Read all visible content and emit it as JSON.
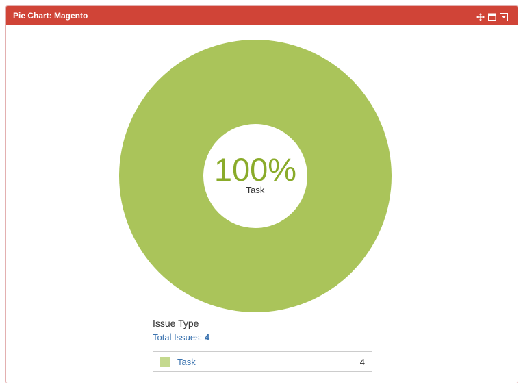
{
  "gadget": {
    "title": "Pie Chart: Magento",
    "icons": [
      "move-icon",
      "maximize-icon",
      "menu-dropdown-icon"
    ],
    "header_color": "#d04437"
  },
  "chart_data": {
    "type": "pie",
    "style": "donut",
    "slices": [
      {
        "label": "Task",
        "value": 4,
        "percent": 100,
        "color": "#aac45a"
      }
    ],
    "center_text": "100%",
    "center_label": "Task",
    "center_text_color": "#8aab2a"
  },
  "legend": {
    "title": "Issue Type",
    "total_label": "Total Issues:",
    "total_count": "4",
    "rows": [
      {
        "label": "Task",
        "count": "4",
        "swatch_color": "#c4d98e"
      }
    ]
  }
}
